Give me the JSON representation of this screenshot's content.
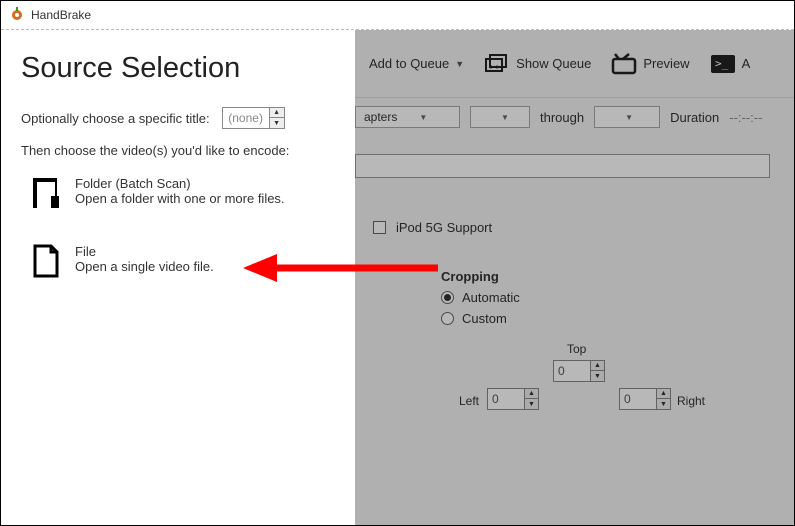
{
  "title": {
    "app_name": "HandBrake"
  },
  "src": {
    "heading": "Source Selection",
    "title_label": "Optionally choose a specific title:",
    "title_value": "(none)",
    "instruction": "Then choose the video(s) you'd like to encode:",
    "folder": {
      "title": "Folder (Batch Scan)",
      "desc": "Open a folder with one or more files."
    },
    "file": {
      "title": "File",
      "desc": "Open a single video file."
    }
  },
  "toolbar": {
    "add_queue": "Add to Queue",
    "show_queue": "Show Queue",
    "preview": "Preview",
    "cut_a": "A"
  },
  "controls": {
    "chapters_label": "apters",
    "through": "through",
    "duration_label": "Duration",
    "duration_value": "--:--:--",
    "ipod": "iPod 5G Support"
  },
  "crop": {
    "title": "Cropping",
    "auto": "Automatic",
    "custom": "Custom",
    "top": "Top",
    "left": "Left",
    "right": "Right",
    "val_top": "0",
    "val_left": "0",
    "val_right": "0"
  }
}
